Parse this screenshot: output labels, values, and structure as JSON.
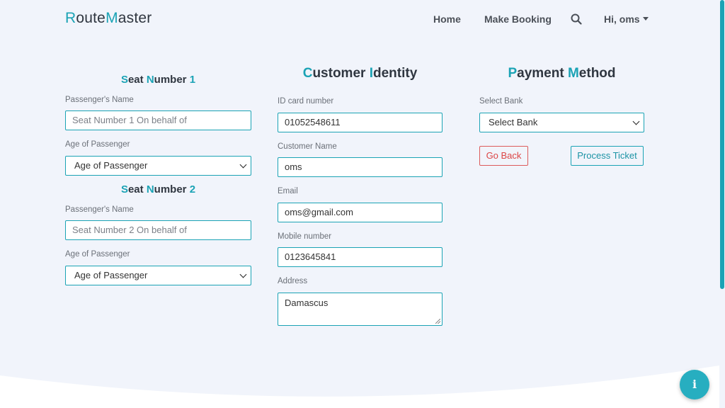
{
  "nav": {
    "brand_r": "R",
    "brand_oute": "oute",
    "brand_m": "M",
    "brand_aster": "aster",
    "home": "Home",
    "make_booking": "Make Booking",
    "user": "Hi, oms"
  },
  "seat1": {
    "title_s": "S",
    "title_eat": "eat ",
    "title_n": "N",
    "title_umber": "umber ",
    "title_num": "1",
    "name_label": "Passenger's Name",
    "name_placeholder": "Seat Number 1 On behalf of",
    "age_label": "Age of Passenger",
    "age_value": "Age of Passenger"
  },
  "seat2": {
    "title_s": "S",
    "title_eat": "eat ",
    "title_n": "N",
    "title_umber": "umber ",
    "title_num": "2",
    "name_label": "Passenger's Name",
    "name_placeholder": "Seat Number 2 On behalf of",
    "age_label": "Age of Passenger",
    "age_value": "Age of Passenger"
  },
  "identity": {
    "title_c": "C",
    "title_ustomer": "ustomer ",
    "title_i": "I",
    "title_dentity": "dentity",
    "id_label": "ID card number",
    "id_value": "01052548611",
    "name_label": "Customer Name",
    "name_value": "oms",
    "email_label": "Email",
    "email_value": "oms@gmail.com",
    "mobile_label": "Mobile number",
    "mobile_value": "0123645841",
    "address_label": "Address",
    "address_value": "Damascus"
  },
  "payment": {
    "title_p": "P",
    "title_ayment": "ayment ",
    "title_m": "M",
    "title_ethod": "ethod",
    "bank_label": "Select Bank",
    "bank_value": "Select Bank",
    "back_button": "Go Back",
    "process_button": "Process Ticket"
  },
  "fab": {
    "info_glyph": "i"
  },
  "colors": {
    "accent": "#1ba3b5",
    "danger": "#dc4545",
    "background": "#f1f4fb"
  }
}
